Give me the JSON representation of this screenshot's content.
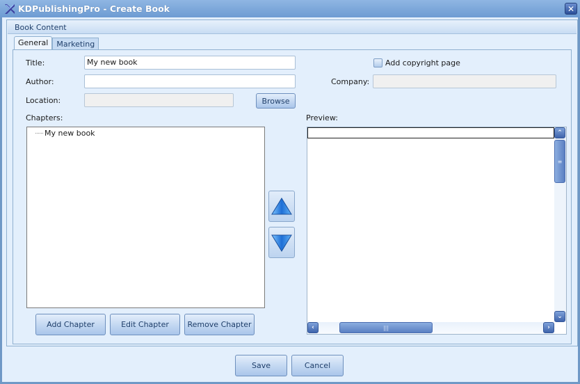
{
  "window": {
    "title": "KDPublishingPro - Create Book",
    "close_glyph": "✕",
    "app_icon": "kd-logo-icon"
  },
  "group": {
    "header": "Book Content"
  },
  "tabs": [
    {
      "label": "General",
      "active": true
    },
    {
      "label": "Marketing",
      "active": false
    }
  ],
  "form": {
    "title_label": "Title:",
    "title_value": "My new book",
    "author_label": "Author:",
    "author_value": "",
    "location_label": "Location:",
    "location_value": "",
    "browse_label": "Browse",
    "copyright_label": "Add copyright page",
    "copyright_checked": false,
    "company_label": "Company:",
    "company_value": ""
  },
  "chapters": {
    "label": "Chapters:",
    "items": [
      "My new book"
    ],
    "move_up_icon": "triangle-up-icon",
    "move_down_icon": "triangle-down-icon",
    "add_label": "Add Chapter",
    "edit_label": "Edit Chapter",
    "remove_label": "Remove Chapter"
  },
  "preview": {
    "label": "Preview:",
    "scroll_up_glyph": "⌃",
    "scroll_down_glyph": "⌄",
    "scroll_left_glyph": "‹",
    "scroll_right_glyph": "›",
    "grip_v": "≡",
    "grip_h": "|||"
  },
  "footer": {
    "save_label": "Save",
    "cancel_label": "Cancel"
  }
}
